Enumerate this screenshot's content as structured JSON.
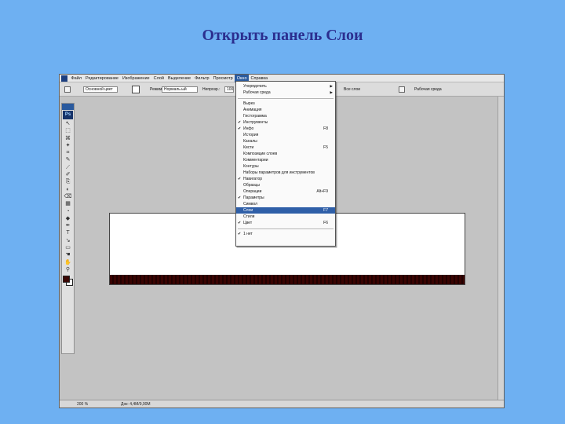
{
  "slide": {
    "title": "Открыть панель Слои"
  },
  "menubar": {
    "items": [
      "Файл",
      "Редактирование",
      "Изображение",
      "Слой",
      "Выделение",
      "Фильтр",
      "Просмотр",
      "Окно",
      "Справка"
    ],
    "active": "Окно"
  },
  "options_bar": {
    "mode_value": "Основной цвет",
    "fill_label": "Режим:",
    "fill_value": "Нормаль.ый",
    "opacity_label": "Непрозр.:",
    "opacity_value": "100%",
    "tolerance_label": "Допуск:",
    "all_layers_label": "Все слои",
    "workspace_label": "Рабочая среда"
  },
  "toolbox": {
    "logo": "Ps",
    "foreground_color": "#3b0704",
    "background_color": "#ffffff"
  },
  "status_bar": {
    "zoom": "200 %",
    "doc_info": "Док: 4,4M/9,00M"
  },
  "window_menu": {
    "items": [
      {
        "label": "Упорядочить",
        "checked": false,
        "shortcut": "",
        "submenu": true
      },
      {
        "label": "Рабочая среда",
        "checked": false,
        "shortcut": "",
        "submenu": true
      },
      {
        "separator": true
      },
      {
        "label": "Вырез",
        "checked": false,
        "shortcut": ""
      },
      {
        "label": "Анимация",
        "checked": false,
        "shortcut": ""
      },
      {
        "label": "Гистограмма",
        "checked": false,
        "shortcut": ""
      },
      {
        "label": "Инструменты",
        "checked": true,
        "shortcut": ""
      },
      {
        "label": "Инфо",
        "checked": true,
        "shortcut": "F8"
      },
      {
        "label": "История",
        "checked": false,
        "shortcut": ""
      },
      {
        "label": "Каналы",
        "checked": false,
        "shortcut": ""
      },
      {
        "label": "Кисти",
        "checked": false,
        "shortcut": "F5"
      },
      {
        "label": "Композиции слоев",
        "checked": false,
        "shortcut": ""
      },
      {
        "label": "Комментарии",
        "checked": false,
        "shortcut": ""
      },
      {
        "label": "Контуры",
        "checked": false,
        "shortcut": ""
      },
      {
        "label": "Наборы параметров для инструментов",
        "checked": false,
        "shortcut": ""
      },
      {
        "label": "Навигатор",
        "checked": true,
        "shortcut": ""
      },
      {
        "label": "Образцы",
        "checked": false,
        "shortcut": ""
      },
      {
        "label": "Операции",
        "checked": false,
        "shortcut": "Alt+F9"
      },
      {
        "label": "Параметры",
        "checked": true,
        "shortcut": ""
      },
      {
        "label": "Символ",
        "checked": false,
        "shortcut": ""
      },
      {
        "label": "Слои",
        "checked": false,
        "shortcut": "F7",
        "selected": true
      },
      {
        "label": "Стили",
        "checked": false,
        "shortcut": ""
      },
      {
        "label": "Цвет",
        "checked": true,
        "shortcut": "F6"
      },
      {
        "separator": true
      },
      {
        "label": "1 нет",
        "checked": true,
        "shortcut": ""
      }
    ]
  }
}
